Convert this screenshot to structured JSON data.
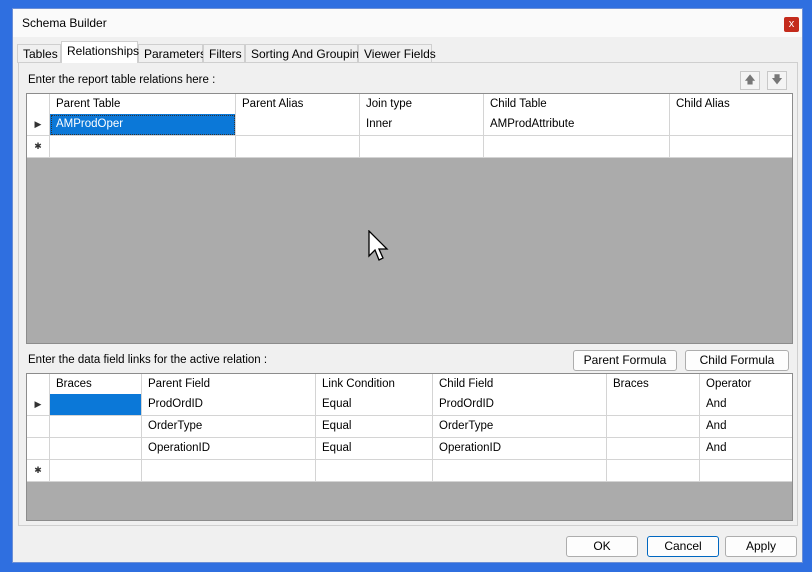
{
  "window": {
    "title": "Schema Builder",
    "close_label": "x"
  },
  "tabs": [
    "Tables",
    "Relationships",
    "Parameters",
    "Filters",
    "Sorting And Grouping",
    "Viewer Fields"
  ],
  "active_tab": "Relationships",
  "relations": {
    "label": "Enter the report table relations here :",
    "move_up_icon": "up-arrow-icon",
    "move_down_icon": "down-arrow-icon",
    "headers": [
      "Parent Table",
      "Parent Alias",
      "Join type",
      "Child Table",
      "Child Alias"
    ],
    "rows": [
      [
        "AMProdOper",
        "",
        "Inner",
        "AMProdAttribute",
        ""
      ]
    ]
  },
  "links": {
    "label": "Enter the data field links for the active relation :",
    "parent_formula_label": "Parent Formula",
    "child_formula_label": "Child Formula",
    "headers": [
      "Braces",
      "Parent Field",
      "Link Condition",
      "Child Field",
      "Braces",
      "Operator"
    ],
    "rows": [
      [
        "",
        "ProdOrdID",
        "Equal",
        "ProdOrdID",
        "",
        "And"
      ],
      [
        "",
        "OrderType",
        "Equal",
        "OrderType",
        "",
        "And"
      ],
      [
        "",
        "OperationID",
        "Equal",
        "OperationID",
        "",
        "And"
      ]
    ]
  },
  "row_marker_current": "▶",
  "row_marker_new": "✱",
  "footer": {
    "ok_label": "OK",
    "cancel_label": "Cancel",
    "apply_label": "Apply"
  }
}
